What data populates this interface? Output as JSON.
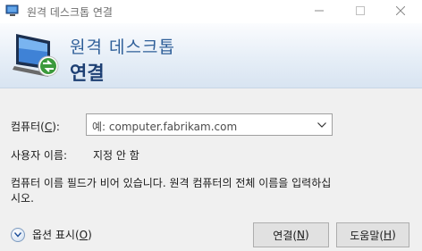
{
  "window": {
    "title": "원격 데스크톱 연결",
    "controls": {
      "minimize": "minimize",
      "maximize": "maximize",
      "close": "close"
    }
  },
  "banner": {
    "title_line1": "원격 데스크톱",
    "title_line2": "연결"
  },
  "form": {
    "computer": {
      "label_before": "컴퓨터(",
      "accel": "C",
      "label_after": "):",
      "placeholder": "예: computer.fabrikam.com"
    },
    "username": {
      "label": "사용자 이름:",
      "value": "지정 안 함"
    },
    "info_text": "컴퓨터 이름 필드가 비어 있습니다. 원격 컴퓨터의 전체 이름을 입력하십시오."
  },
  "options": {
    "label_before": "옵션 표시(",
    "accel": "O",
    "label_after": ")"
  },
  "buttons": {
    "connect": {
      "label_before": "연결(",
      "accel": "N",
      "label_after": ")"
    },
    "help": {
      "label_before": "도움말(",
      "accel": "H",
      "label_after": ")"
    }
  },
  "colors": {
    "banner_title": "#2f5f99",
    "banner_bold": "#1d3f73",
    "window_bg": "#f0f0f0",
    "button_bg": "#e1e1e1"
  }
}
